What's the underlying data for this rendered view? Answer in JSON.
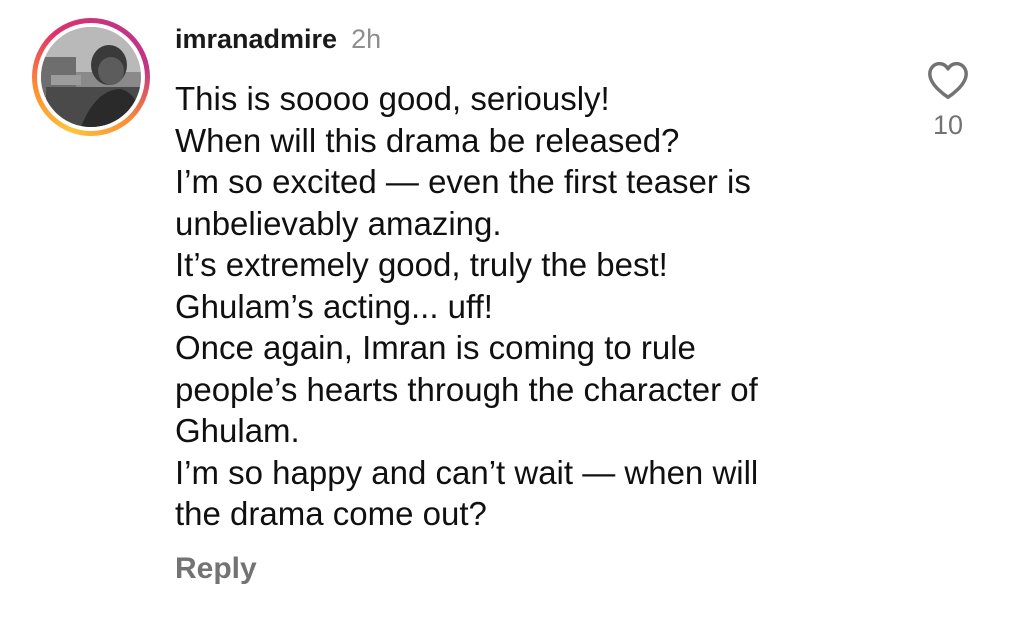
{
  "comment": {
    "username": "imranadmire",
    "time": "2h",
    "lines": [
      "This is soooo good, seriously!",
      "When will this drama be released?",
      "I’m so excited — even the first teaser is",
      "unbelievably amazing.",
      "It’s extremely good, truly the best!",
      "Ghulam’s acting... uff!",
      "Once again, Imran is coming to rule",
      "people’s hearts through the character of",
      "Ghulam.",
      "I’m so happy and can’t wait — when will",
      "the drama come out?"
    ],
    "reply_label": "Reply",
    "like_count": "10",
    "like_icon": "heart-outline-icon"
  },
  "colors": {
    "text": "#101010",
    "muted": "#737373",
    "timestamp": "#8e8e8e",
    "story_ring": [
      "#fdc43a",
      "#fd8d32",
      "#e1306c",
      "#c13584"
    ]
  }
}
